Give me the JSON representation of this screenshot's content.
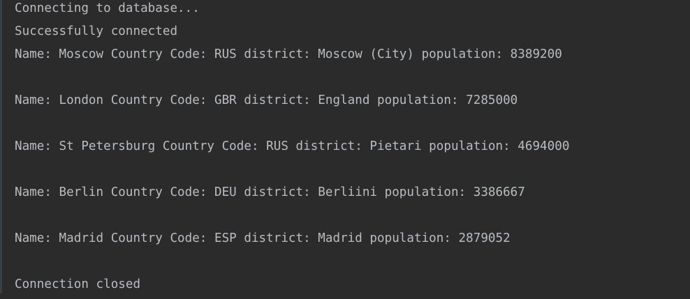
{
  "console": {
    "lines": [
      "Connecting to database...",
      "Successfully connected",
      "Name: Moscow Country Code: RUS district: Moscow (City) population: 8389200",
      "",
      "Name: London Country Code: GBR district: England population: 7285000",
      "",
      "Name: St Petersburg Country Code: RUS district: Pietari population: 4694000",
      "",
      "Name: Berlin Country Code: DEU district: Berliini population: 3386667",
      "",
      "Name: Madrid Country Code: ESP district: Madrid population: 2879052",
      "",
      "Connection closed"
    ]
  }
}
